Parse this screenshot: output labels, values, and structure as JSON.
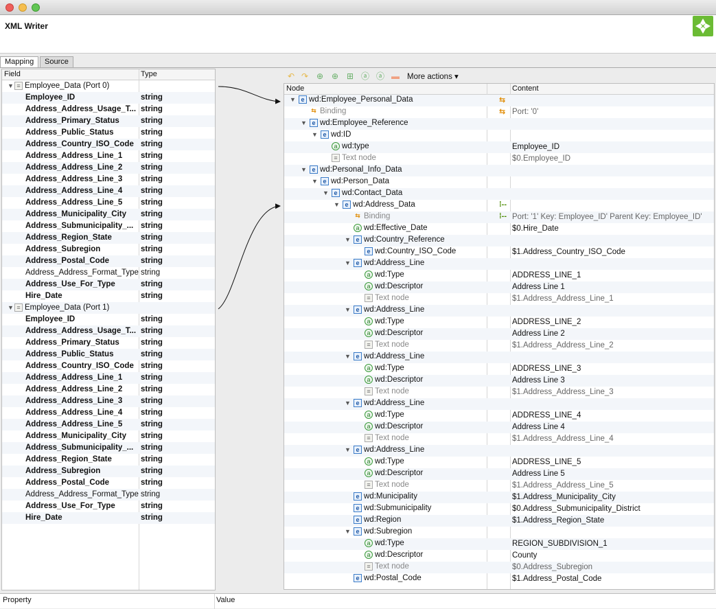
{
  "window": {
    "title": "XML Writer"
  },
  "tabs": [
    {
      "label": "Mapping",
      "active": true
    },
    {
      "label": "Source",
      "active": false
    }
  ],
  "left_panel": {
    "col_field": "Field",
    "col_type": "Type",
    "rows": [
      {
        "kind": "group",
        "label": "Employee_Data (Port 0)"
      },
      {
        "f": "Employee_ID",
        "t": "string",
        "b": true
      },
      {
        "f": "Address_Address_Usage_T...",
        "t": "string",
        "b": true
      },
      {
        "f": "Address_Primary_Status",
        "t": "string",
        "b": true
      },
      {
        "f": "Address_Public_Status",
        "t": "string",
        "b": true
      },
      {
        "f": "Address_Country_ISO_Code",
        "t": "string",
        "b": true
      },
      {
        "f": "Address_Address_Line_1",
        "t": "string",
        "b": true
      },
      {
        "f": "Address_Address_Line_2",
        "t": "string",
        "b": true
      },
      {
        "f": "Address_Address_Line_3",
        "t": "string",
        "b": true
      },
      {
        "f": "Address_Address_Line_4",
        "t": "string",
        "b": true
      },
      {
        "f": "Address_Address_Line_5",
        "t": "string",
        "b": true
      },
      {
        "f": "Address_Municipality_City",
        "t": "string",
        "b": true
      },
      {
        "f": "Address_Submunicipality_...",
        "t": "string",
        "b": true
      },
      {
        "f": "Address_Region_State",
        "t": "string",
        "b": true
      },
      {
        "f": "Address_Subregion",
        "t": "string",
        "b": true
      },
      {
        "f": "Address_Postal_Code",
        "t": "string",
        "b": true
      },
      {
        "f": "Address_Address_Format_Type",
        "t": "string",
        "b": false
      },
      {
        "f": "Address_Use_For_Type",
        "t": "string",
        "b": true
      },
      {
        "f": "Hire_Date",
        "t": "string",
        "b": true
      },
      {
        "kind": "group",
        "label": "Employee_Data (Port 1)"
      },
      {
        "f": "Employee_ID",
        "t": "string",
        "b": true
      },
      {
        "f": "Address_Address_Usage_T...",
        "t": "string",
        "b": true
      },
      {
        "f": "Address_Primary_Status",
        "t": "string",
        "b": true
      },
      {
        "f": "Address_Public_Status",
        "t": "string",
        "b": true
      },
      {
        "f": "Address_Country_ISO_Code",
        "t": "string",
        "b": true
      },
      {
        "f": "Address_Address_Line_1",
        "t": "string",
        "b": true
      },
      {
        "f": "Address_Address_Line_2",
        "t": "string",
        "b": true
      },
      {
        "f": "Address_Address_Line_3",
        "t": "string",
        "b": true
      },
      {
        "f": "Address_Address_Line_4",
        "t": "string",
        "b": true
      },
      {
        "f": "Address_Address_Line_5",
        "t": "string",
        "b": true
      },
      {
        "f": "Address_Municipality_City",
        "t": "string",
        "b": true
      },
      {
        "f": "Address_Submunicipality_...",
        "t": "string",
        "b": true
      },
      {
        "f": "Address_Region_State",
        "t": "string",
        "b": true
      },
      {
        "f": "Address_Subregion",
        "t": "string",
        "b": true
      },
      {
        "f": "Address_Postal_Code",
        "t": "string",
        "b": true
      },
      {
        "f": "Address_Address_Format_Type",
        "t": "string",
        "b": false
      },
      {
        "f": "Address_Use_For_Type",
        "t": "string",
        "b": true
      },
      {
        "f": "Hire_Date",
        "t": "string",
        "b": true
      }
    ]
  },
  "toolbar": {
    "more_actions": "More actions ▾"
  },
  "right_panel": {
    "col_node": "Node",
    "col_content": "Content",
    "rows": [
      {
        "d": 1,
        "tri": true,
        "ic": "e",
        "n": "wd:Employee_Personal_Data",
        "c": "",
        "m": "bind"
      },
      {
        "d": 2,
        "tri": false,
        "ic": "b",
        "n": "Binding",
        "c": "Port: '0'",
        "grey": true,
        "m": "bind"
      },
      {
        "d": 2,
        "tri": true,
        "ic": "e",
        "n": "wd:Employee_Reference",
        "c": ""
      },
      {
        "d": 3,
        "tri": true,
        "ic": "e",
        "n": "wd:ID",
        "c": ""
      },
      {
        "d": 4,
        "tri": false,
        "ic": "a",
        "n": "wd:type",
        "c": "Employee_ID"
      },
      {
        "d": 4,
        "tri": false,
        "ic": "t",
        "n": "Text node",
        "c": "$0.Employee_ID",
        "grey": true
      },
      {
        "d": 2,
        "tri": true,
        "ic": "e",
        "n": "wd:Personal_Info_Data",
        "c": ""
      },
      {
        "d": 3,
        "tri": true,
        "ic": "e",
        "n": "wd:Person_Data",
        "c": ""
      },
      {
        "d": 4,
        "tri": true,
        "ic": "e",
        "n": "wd:Contact_Data",
        "c": ""
      },
      {
        "d": 5,
        "tri": true,
        "ic": "e",
        "n": "wd:Address_Data",
        "c": "",
        "m": "dash"
      },
      {
        "d": 6,
        "tri": false,
        "ic": "b",
        "n": "Binding",
        "c": "Port: '1' Key: Employee_ID' Parent Key: Employee_ID'",
        "grey": true,
        "m": "dash"
      },
      {
        "d": 6,
        "tri": false,
        "ic": "a",
        "n": "wd:Effective_Date",
        "c": "$0.Hire_Date"
      },
      {
        "d": 6,
        "tri": true,
        "ic": "e",
        "n": "wd:Country_Reference",
        "c": ""
      },
      {
        "d": 7,
        "tri": false,
        "ic": "e",
        "n": "wd:Country_ISO_Code",
        "c": "$1.Address_Country_ISO_Code"
      },
      {
        "d": 6,
        "tri": true,
        "ic": "e",
        "n": "wd:Address_Line",
        "c": ""
      },
      {
        "d": 7,
        "tri": false,
        "ic": "a",
        "n": "wd:Type",
        "c": "ADDRESS_LINE_1"
      },
      {
        "d": 7,
        "tri": false,
        "ic": "a",
        "n": "wd:Descriptor",
        "c": "Address Line 1"
      },
      {
        "d": 7,
        "tri": false,
        "ic": "t",
        "n": "Text node",
        "c": "$1.Address_Address_Line_1",
        "grey": true
      },
      {
        "d": 6,
        "tri": true,
        "ic": "e",
        "n": "wd:Address_Line",
        "c": ""
      },
      {
        "d": 7,
        "tri": false,
        "ic": "a",
        "n": "wd:Type",
        "c": "ADDRESS_LINE_2"
      },
      {
        "d": 7,
        "tri": false,
        "ic": "a",
        "n": "wd:Descriptor",
        "c": "Address Line 2"
      },
      {
        "d": 7,
        "tri": false,
        "ic": "t",
        "n": "Text node",
        "c": "$1.Address_Address_Line_2",
        "grey": true
      },
      {
        "d": 6,
        "tri": true,
        "ic": "e",
        "n": "wd:Address_Line",
        "c": ""
      },
      {
        "d": 7,
        "tri": false,
        "ic": "a",
        "n": "wd:Type",
        "c": "ADDRESS_LINE_3"
      },
      {
        "d": 7,
        "tri": false,
        "ic": "a",
        "n": "wd:Descriptor",
        "c": "Address Line 3"
      },
      {
        "d": 7,
        "tri": false,
        "ic": "t",
        "n": "Text node",
        "c": "$1.Address_Address_Line_3",
        "grey": true
      },
      {
        "d": 6,
        "tri": true,
        "ic": "e",
        "n": "wd:Address_Line",
        "c": ""
      },
      {
        "d": 7,
        "tri": false,
        "ic": "a",
        "n": "wd:Type",
        "c": "ADDRESS_LINE_4"
      },
      {
        "d": 7,
        "tri": false,
        "ic": "a",
        "n": "wd:Descriptor",
        "c": "Address Line 4"
      },
      {
        "d": 7,
        "tri": false,
        "ic": "t",
        "n": "Text node",
        "c": "$1.Address_Address_Line_4",
        "grey": true
      },
      {
        "d": 6,
        "tri": true,
        "ic": "e",
        "n": "wd:Address_Line",
        "c": ""
      },
      {
        "d": 7,
        "tri": false,
        "ic": "a",
        "n": "wd:Type",
        "c": "ADDRESS_LINE_5"
      },
      {
        "d": 7,
        "tri": false,
        "ic": "a",
        "n": "wd:Descriptor",
        "c": "Address Line 5"
      },
      {
        "d": 7,
        "tri": false,
        "ic": "t",
        "n": "Text node",
        "c": "$1.Address_Address_Line_5",
        "grey": true
      },
      {
        "d": 6,
        "tri": false,
        "ic": "e",
        "n": "wd:Municipality",
        "c": "$1.Address_Municipality_City"
      },
      {
        "d": 6,
        "tri": false,
        "ic": "e",
        "n": "wd:Submunicipality",
        "c": "$0.Address_Submunicipality_District"
      },
      {
        "d": 6,
        "tri": false,
        "ic": "e",
        "n": "wd:Region",
        "c": "$1.Address_Region_State"
      },
      {
        "d": 6,
        "tri": true,
        "ic": "e",
        "n": "wd:Subregion",
        "c": ""
      },
      {
        "d": 7,
        "tri": false,
        "ic": "a",
        "n": "wd:Type",
        "c": "REGION_SUBDIVISION_1"
      },
      {
        "d": 7,
        "tri": false,
        "ic": "a",
        "n": "wd:Descriptor",
        "c": "County"
      },
      {
        "d": 7,
        "tri": false,
        "ic": "t",
        "n": "Text node",
        "c": "$0.Address_Subregion",
        "grey": true
      },
      {
        "d": 6,
        "tri": false,
        "ic": "e",
        "n": "wd:Postal_Code",
        "c": "$1.Address_Postal_Code"
      }
    ]
  },
  "bottom": {
    "property": "Property",
    "value": "Value"
  },
  "icons": [
    "undo-icon",
    "redo-icon",
    "add-child-icon",
    "add-element-icon",
    "add-attribute-icon",
    "add-text-icon",
    "add-wildcard-icon",
    "remove-icon"
  ]
}
